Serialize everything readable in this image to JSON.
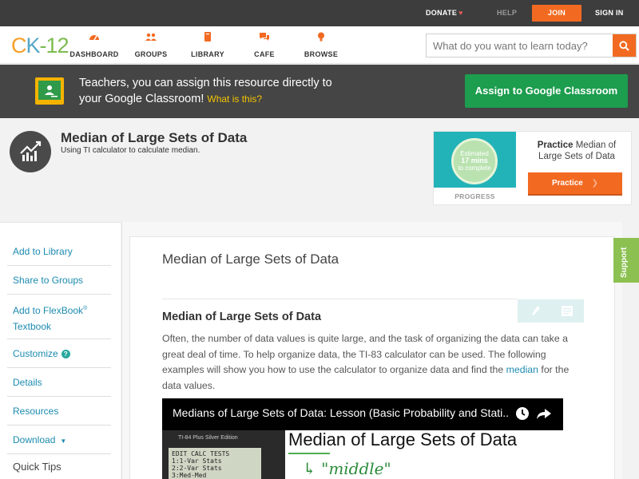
{
  "topbar": {
    "donate": "DONATE",
    "help": "HELP",
    "join": "JOIN",
    "signin": "SIGN IN"
  },
  "nav": {
    "logo": {
      "c": "C",
      "k": "K",
      "n": "-12"
    },
    "items": [
      {
        "label": "DASHBOARD",
        "icon": "dashboard-icon"
      },
      {
        "label": "GROUPS",
        "icon": "groups-icon"
      },
      {
        "label": "LIBRARY",
        "icon": "library-icon"
      },
      {
        "label": "CAFE",
        "icon": "cafe-icon"
      },
      {
        "label": "BROWSE",
        "icon": "browse-icon"
      }
    ],
    "search_placeholder": "What do you want to learn today?"
  },
  "banner": {
    "line1": "Teachers, you can assign this resource directly to",
    "line2": "your Google Classroom!",
    "what": "What is this?",
    "assign": "Assign to Google Classroom"
  },
  "header": {
    "title": "Median of Large Sets of Data",
    "subtitle": "Using TI calculator to calculate median."
  },
  "practice": {
    "estimated": "Estimated",
    "mins": "17 mins",
    "to_complete": "to complete",
    "progress": "PROGRESS",
    "title_bold": "Practice",
    "title_rest": "Median of Large Sets of Data",
    "button": "Practice"
  },
  "sidebar": {
    "add_library": "Add to Library",
    "share_groups": "Share to Groups",
    "add_flexbook_1": "Add to FlexBook",
    "add_flexbook_reg": "®",
    "add_flexbook_2": "Textbook",
    "customize": "Customize",
    "customize_q": "?",
    "details": "Details",
    "resources": "Resources",
    "download": "Download",
    "download_caret": "▼",
    "quick_tips": "Quick Tips"
  },
  "main": {
    "lesson_title": "Median of Large Sets of Data",
    "section_title": "Median of Large Sets of Data",
    "para_before": "Often, the number of data values is quite large, and the task of organizing the data can take a great deal of time. To help organize data, the TI-83 calculator can be used. The following examples will show you how to use the calculator to organize data and find the ",
    "para_link": "median",
    "para_after": " for the data values.",
    "video_title": "Medians of Large Sets of Data: Lesson (Basic Probability and Stati...",
    "calc_brand": "TI-84 Plus Silver Edition",
    "calc_screen_l1": "EDIT CALC TESTS",
    "calc_screen_l2": "1:1-Var Stats",
    "calc_screen_l3": "2:2-Var Stats",
    "calc_screen_l4": "3:Med-Med",
    "board_title": "Median of Large Sets of Data",
    "board_note": "↳ \"middle\""
  },
  "support": "Support",
  "colors": {
    "orange": "#f26a21",
    "green": "#1d9d4e",
    "link": "#1c8bb0",
    "support": "#8cc152"
  }
}
